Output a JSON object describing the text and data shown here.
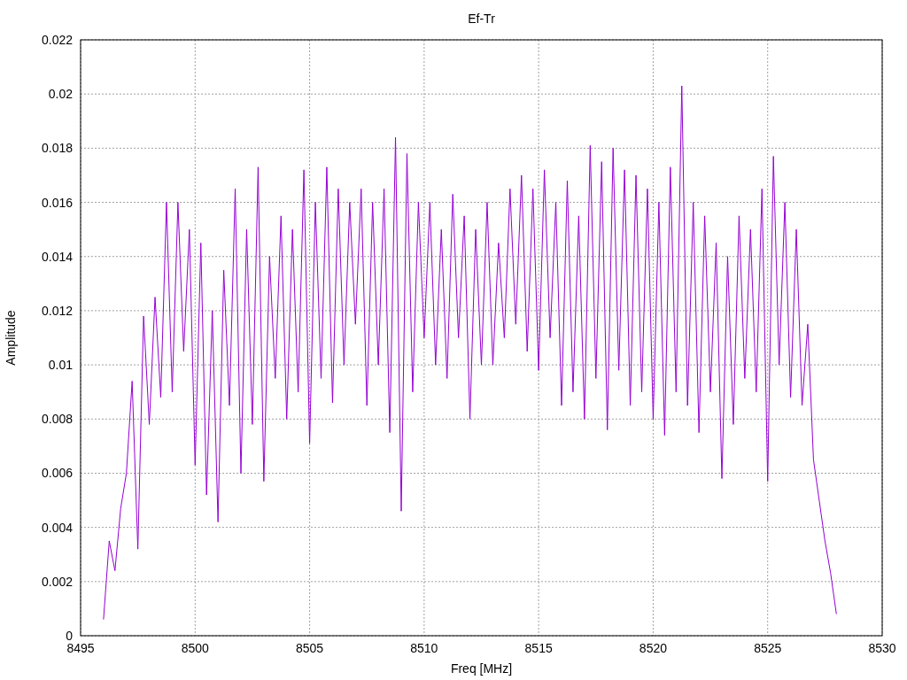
{
  "chart_data": {
    "type": "line",
    "grid": true,
    "title": "Ef-Tr",
    "xlabel": "Freq [MHz]",
    "ylabel": "Amplitude",
    "xlim": [
      8495,
      8530
    ],
    "ylim": [
      0,
      0.022
    ],
    "xticks": [
      8495,
      8500,
      8505,
      8510,
      8515,
      8520,
      8525,
      8530
    ],
    "yticks": [
      0,
      0.002,
      0.004,
      0.006,
      0.008,
      0.01,
      0.012,
      0.014,
      0.016,
      0.018,
      0.02,
      0.022
    ],
    "x": [
      8496,
      8496.25,
      8496.5,
      8496.75,
      8497,
      8497.25,
      8497.5,
      8497.75,
      8498,
      8498.25,
      8498.5,
      8498.75,
      8499,
      8499.25,
      8499.5,
      8499.75,
      8500,
      8500.25,
      8500.5,
      8500.75,
      8501,
      8501.25,
      8501.5,
      8501.75,
      8502,
      8502.25,
      8502.5,
      8502.75,
      8503,
      8503.25,
      8503.5,
      8503.75,
      8504,
      8504.25,
      8504.5,
      8504.75,
      8505,
      8505.25,
      8505.5,
      8505.75,
      8506,
      8506.25,
      8506.5,
      8506.75,
      8507,
      8507.25,
      8507.5,
      8507.75,
      8508,
      8508.25,
      8508.5,
      8508.75,
      8509,
      8509.25,
      8509.5,
      8509.75,
      8510,
      8510.25,
      8510.5,
      8510.75,
      8511,
      8511.25,
      8511.5,
      8511.75,
      8512,
      8512.25,
      8512.5,
      8512.75,
      8513,
      8513.25,
      8513.5,
      8513.75,
      8514,
      8514.25,
      8514.5,
      8514.75,
      8515,
      8515.25,
      8515.5,
      8515.75,
      8516,
      8516.25,
      8516.5,
      8516.75,
      8517,
      8517.25,
      8517.5,
      8517.75,
      8518,
      8518.25,
      8518.5,
      8518.75,
      8519,
      8519.25,
      8519.5,
      8519.75,
      8520,
      8520.25,
      8520.5,
      8520.75,
      8521,
      8521.25,
      8521.5,
      8521.75,
      8522,
      8522.25,
      8522.5,
      8522.75,
      8523,
      8523.25,
      8523.5,
      8523.75,
      8524,
      8524.25,
      8524.5,
      8524.75,
      8525,
      8525.25,
      8525.5,
      8525.75,
      8526,
      8526.25,
      8526.5,
      8526.75,
      8527,
      8527.25,
      8527.5,
      8527.75,
      8528
    ],
    "series": [
      {
        "color": "#9400d3",
        "values": [
          0.0006,
          0.0035,
          0.0024,
          0.0047,
          0.006,
          0.0094,
          0.0032,
          0.0118,
          0.0078,
          0.0125,
          0.0088,
          0.016,
          0.009,
          0.016,
          0.0105,
          0.015,
          0.0063,
          0.0145,
          0.0052,
          0.012,
          0.0042,
          0.0135,
          0.0085,
          0.0165,
          0.006,
          0.015,
          0.0078,
          0.0173,
          0.0057,
          0.014,
          0.0095,
          0.0155,
          0.008,
          0.015,
          0.009,
          0.0172,
          0.0071,
          0.016,
          0.0095,
          0.0173,
          0.0086,
          0.0165,
          0.01,
          0.016,
          0.0115,
          0.0165,
          0.0085,
          0.016,
          0.01,
          0.0165,
          0.0075,
          0.0184,
          0.0046,
          0.0178,
          0.009,
          0.016,
          0.011,
          0.016,
          0.01,
          0.015,
          0.0095,
          0.0163,
          0.011,
          0.0155,
          0.008,
          0.015,
          0.01,
          0.016,
          0.01,
          0.0145,
          0.011,
          0.0165,
          0.0115,
          0.017,
          0.0105,
          0.0165,
          0.0098,
          0.0172,
          0.011,
          0.016,
          0.0085,
          0.0168,
          0.009,
          0.0155,
          0.008,
          0.0181,
          0.0095,
          0.0175,
          0.0076,
          0.018,
          0.0098,
          0.0172,
          0.0085,
          0.017,
          0.009,
          0.0165,
          0.008,
          0.016,
          0.0074,
          0.0173,
          0.009,
          0.0203,
          0.0085,
          0.016,
          0.0075,
          0.0155,
          0.009,
          0.0145,
          0.0058,
          0.014,
          0.0078,
          0.0155,
          0.0095,
          0.015,
          0.009,
          0.0165,
          0.0057,
          0.0177,
          0.01,
          0.016,
          0.0088,
          0.015,
          0.0085,
          0.0115,
          0.0065,
          0.005,
          0.0035,
          0.0023,
          0.0008
        ]
      }
    ]
  }
}
